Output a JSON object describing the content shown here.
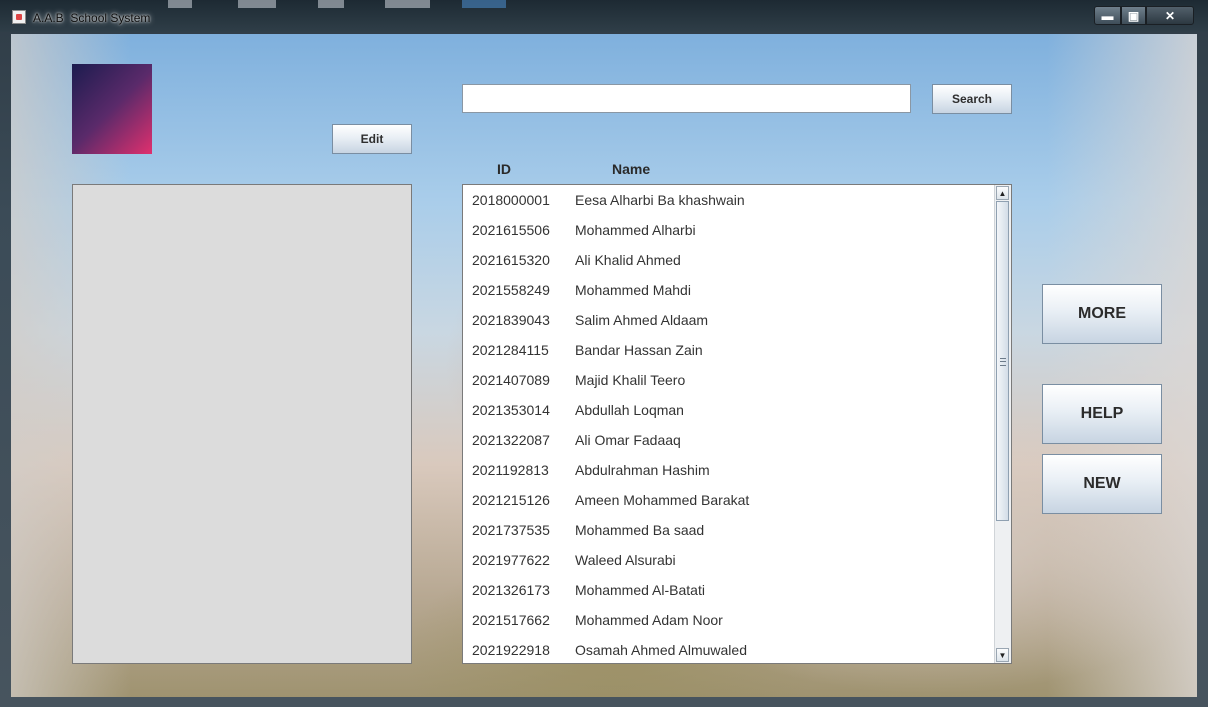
{
  "window": {
    "title": "A.A.B  School System",
    "controls": {
      "minimize": "▬",
      "maximize": "▣",
      "close": "✕"
    }
  },
  "toolbar": {
    "edit_label": "Edit",
    "search_label": "Search",
    "search_value": ""
  },
  "list": {
    "columns": {
      "id": "ID",
      "name": "Name"
    },
    "rows": [
      {
        "id": "2018000001",
        "name": "Eesa Alharbi Ba khashwain"
      },
      {
        "id": "2021615506",
        "name": "Mohammed Alharbi"
      },
      {
        "id": "2021615320",
        "name": "Ali Khalid Ahmed"
      },
      {
        "id": "2021558249",
        "name": "Mohammed Mahdi"
      },
      {
        "id": "2021839043",
        "name": "Salim Ahmed Aldaam"
      },
      {
        "id": "2021284115",
        "name": "Bandar Hassan Zain"
      },
      {
        "id": "2021407089",
        "name": "Majid Khalil Teero"
      },
      {
        "id": "2021353014",
        "name": "Abdullah Loqman"
      },
      {
        "id": "2021322087",
        "name": "Ali Omar Fadaaq"
      },
      {
        "id": "2021192813",
        "name": "Abdulrahman Hashim"
      },
      {
        "id": "2021215126",
        "name": "Ameen Mohammed Barakat"
      },
      {
        "id": "2021737535",
        "name": "Mohammed Ba saad"
      },
      {
        "id": "2021977622",
        "name": "Waleed Alsurabi"
      },
      {
        "id": "2021326173",
        "name": "Mohammed Al-Batati"
      },
      {
        "id": "2021517662",
        "name": "Mohammed Adam Noor"
      },
      {
        "id": "2021922918",
        "name": "Osamah Ahmed Almuwaled"
      }
    ]
  },
  "actions": {
    "more_label": "MORE",
    "help_label": "HELP",
    "new_label": "NEW"
  },
  "icons": {
    "app": "java-cup-icon",
    "scroll_up": "▲",
    "scroll_down": "▼"
  },
  "colors": {
    "avatar_start": "#1c1c4f",
    "avatar_end": "#e0306e",
    "panel_gray": "#dcdcdc"
  }
}
